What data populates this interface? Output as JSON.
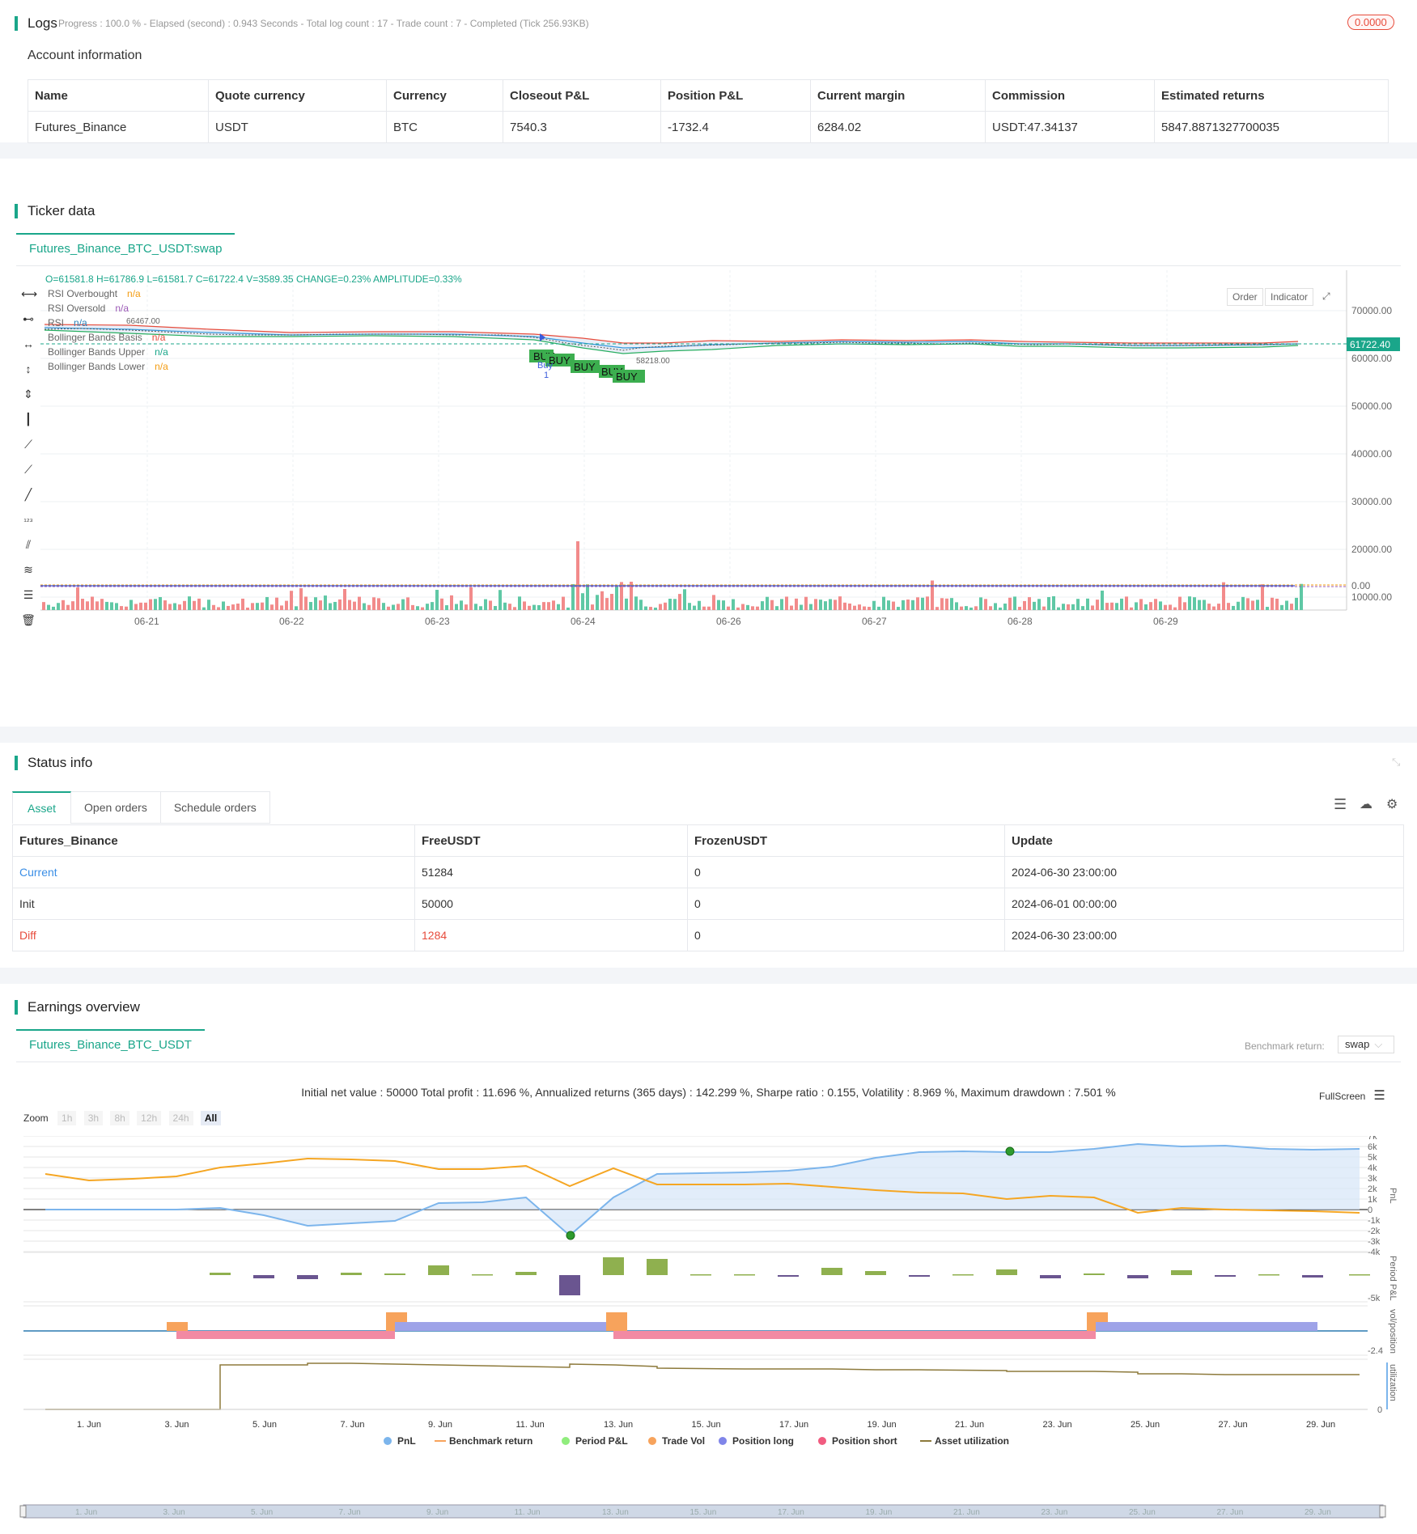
{
  "logs": {
    "title": "Logs",
    "progress_text": "Progress : 100.0 % - Elapsed (second) : 0.943  Seconds - Total log count : 17 - Trade count : 7 - Completed (Tick 256.93KB)",
    "badge": "0.0000"
  },
  "account": {
    "title": "Account information",
    "headers": [
      "Name",
      "Quote currency",
      "Currency",
      "Closeout P&L",
      "Position P&L",
      "Current margin",
      "Commission",
      "Estimated returns"
    ],
    "row": [
      "Futures_Binance",
      "USDT",
      "BTC",
      "7540.3",
      "-1732.4",
      "6284.02",
      "USDT:47.34137",
      "5847.8871327700035"
    ]
  },
  "ticker": {
    "title": "Ticker data",
    "tab": "Futures_Binance_BTC_USDT:swap",
    "ohlc_line": "O=61581.8 H=61786.9 L=61581.7 C=61722.4 V=3589.35 CHANGE=0.23% AMPLITUDE=0.33%",
    "legend": [
      {
        "name": "RSI Overbought",
        "value": "n/a",
        "color": "#f39c12"
      },
      {
        "name": "RSI Oversold",
        "value": "n/a",
        "color": "#9b59b6"
      },
      {
        "name": "RSI",
        "value": "n/a",
        "color": "#2980b9"
      },
      {
        "name": "Bollinger Bands Basis",
        "value": "n/a",
        "color": "#e74c3c"
      },
      {
        "name": "Bollinger Bands Upper",
        "value": "n/a",
        "color": "#1aa68a"
      },
      {
        "name": "Bollinger Bands Lower",
        "value": "n/a",
        "color": "#f39c12"
      }
    ],
    "buttons": {
      "order": "Order",
      "indicator": "Indicator"
    },
    "price_tag": "61722.40",
    "y_ticks": [
      "70000.00",
      "60000.00",
      "50000.00",
      "40000.00",
      "30000.00",
      "20000.00",
      "10000.00",
      "0.00"
    ],
    "x_ticks": [
      "06-21",
      "06-22",
      "06-23",
      "06-24",
      "06-26",
      "06-27",
      "06-28",
      "06-29"
    ],
    "high_label": "66467.00",
    "low_label": "58218.00",
    "buy_label": "BUY",
    "buy_marker": "Buy",
    "buy_marker_num": "1"
  },
  "status": {
    "title": "Status info",
    "tabs": [
      "Asset",
      "Open orders",
      "Schedule orders"
    ],
    "headers": [
      "Futures_Binance",
      "FreeUSDT",
      "FrozenUSDT",
      "Update"
    ],
    "rows": [
      {
        "label": "Current",
        "free": "51284",
        "frozen": "0",
        "update": "2024-06-30 23:00:00"
      },
      {
        "label": "Init",
        "free": "50000",
        "frozen": "0",
        "update": "2024-06-01 00:00:00"
      },
      {
        "label": "Diff",
        "free": "1284",
        "frozen": "0",
        "update": "2024-06-30 23:00:00"
      }
    ]
  },
  "earnings": {
    "title": "Earnings overview",
    "tab": "Futures_Binance_BTC_USDT",
    "benchmark_label": "Benchmark return:",
    "benchmark_value": "swap",
    "summary": "Initial net value : 50000 Total profit : 11.696 %, Annualized returns (365 days) : 142.299 %, Sharpe ratio : 0.155, Volatility : 8.969 %, Maximum drawdown : 7.501 %",
    "fullscreen": "FullScreen",
    "zoom_label": "Zoom",
    "zoom_buttons": [
      "1h",
      "3h",
      "8h",
      "12h",
      "24h",
      "All"
    ],
    "pnl_ticks": [
      "7k",
      "6k",
      "5k",
      "4k",
      "3k",
      "2k",
      "1k",
      "0",
      "-1k",
      "-2k",
      "-3k",
      "-4k"
    ],
    "axis_titles": [
      "PnL",
      "Period P&L",
      "vol/position",
      "utilization"
    ],
    "period_tick": "-5k",
    "vol_tick": "-2.4",
    "util_tick": "0",
    "x_ticks": [
      "1. Jun",
      "3. Jun",
      "5. Jun",
      "7. Jun",
      "9. Jun",
      "11. Jun",
      "13. Jun",
      "15. Jun",
      "17. Jun",
      "19. Jun",
      "21. Jun",
      "23. Jun",
      "25. Jun",
      "27. Jun",
      "29. Jun"
    ],
    "legend": [
      {
        "name": "PnL",
        "color": "#7cb5ec"
      },
      {
        "name": "Benchmark return",
        "color": "#f7a35c"
      },
      {
        "name": "Period P&L",
        "color": "#90ed7d"
      },
      {
        "name": "Trade Vol",
        "color": "#f7a35c"
      },
      {
        "name": "Position long",
        "color": "#8085e9"
      },
      {
        "name": "Position short",
        "color": "#f15c80"
      },
      {
        "name": "Asset utilization",
        "color": "#8d7a3c"
      }
    ]
  }
}
